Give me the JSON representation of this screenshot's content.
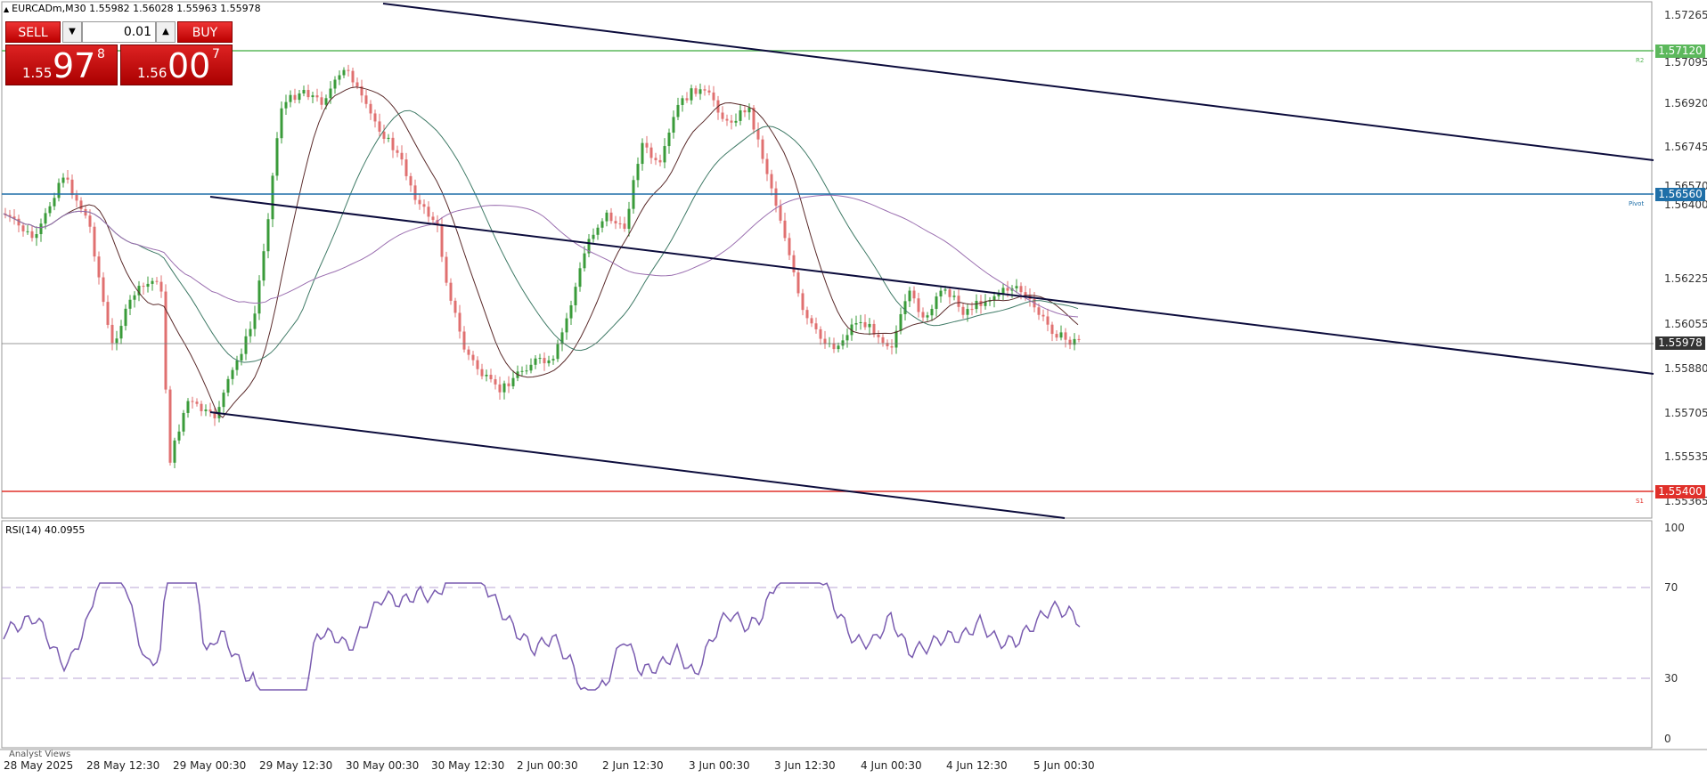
{
  "symbol_line": "EURCADm,M30  1.55982 1.56028 1.55963 1.55978",
  "trade_panel": {
    "sell_label": "SELL",
    "buy_label": "BUY",
    "lot": "0.01",
    "sell_price": {
      "prefix": "1.55",
      "big": "97",
      "sup": "8"
    },
    "buy_price": {
      "prefix": "1.56",
      "big": "00",
      "sup": "7"
    }
  },
  "price_axis": [
    "1.57265",
    "1.57095",
    "1.56920",
    "1.56745",
    "1.56570",
    "1.56400",
    "1.56225",
    "1.56055",
    "1.55880",
    "1.55705",
    "1.55535",
    "1.55365"
  ],
  "price_tags": {
    "green": "1.57120",
    "blue": "1.56560",
    "current": "1.55978",
    "red": "1.55400"
  },
  "line_labels": {
    "green": "R2",
    "blue": "Pivot",
    "red": "S1"
  },
  "colors": {
    "green": "#5cb85c",
    "blue": "#1f6fa8",
    "red": "#e0302a",
    "current": "#333333",
    "bull": "#3a9b3a",
    "bear": "#e07070",
    "rsi": "#7a5cb0"
  },
  "rsi": {
    "label": "RSI(14) 40.0955",
    "levels": [
      "100",
      "70",
      "30",
      "0"
    ]
  },
  "time_axis": [
    "28 May 2025",
    "28 May 12:30",
    "29 May 00:30",
    "29 May 12:30",
    "30 May 00:30",
    "30 May 12:30",
    "2 Jun 00:30",
    "2 Jun 12:30",
    "3 Jun 00:30",
    "3 Jun 12:30",
    "4 Jun 00:30",
    "4 Jun 12:30",
    "5 Jun 00:30"
  ],
  "bottom_tab": "Analyst Views"
}
